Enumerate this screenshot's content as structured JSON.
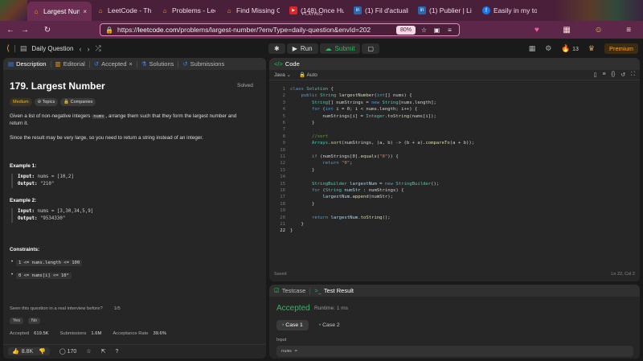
{
  "browser": {
    "tabs": [
      {
        "title": "Largest Numb",
        "icon": "leetcode-icon",
        "active": true
      },
      {
        "title": "LeetCode - The",
        "icon": "leetcode-icon"
      },
      {
        "title": "Problems - Leet",
        "icon": "leetcode-icon"
      },
      {
        "title": "Find Missing Ob",
        "icon": "leetcode-icon"
      },
      {
        "title": "(148) Once Hum",
        "subtitle": "PLAYING",
        "icon": "youtube-icon"
      },
      {
        "title": "(1) Fil d'actualit",
        "icon": "linkedin-icon"
      },
      {
        "title": "(1) Publier | Li",
        "icon": "linkedin-icon"
      },
      {
        "title": "Easily in my to",
        "icon": "facebook-icon"
      }
    ],
    "url_scheme": "https://",
    "url_host": "leetcode.com",
    "url_path": "/problems/largest-number/?envType=daily-question&envId=202",
    "zoom": "80%"
  },
  "header": {
    "daily_label": "Daily Question",
    "run_label": "Run",
    "submit_label": "Submit",
    "streak": "13",
    "premium_label": "Premium"
  },
  "desc_tabs": [
    {
      "label": "Description"
    },
    {
      "label": "Editorial"
    },
    {
      "label": "Accepted"
    },
    {
      "label": "Solutions"
    },
    {
      "label": "Submissions"
    }
  ],
  "problem": {
    "title": "179. Largest Number",
    "solved": "Solved",
    "difficulty": "Medium",
    "topics": "Topics",
    "companies": "Companies",
    "p1_a": "Given a list of non-negative integers ",
    "p1_code": "nums",
    "p1_b": ", arrange them such that they form the largest number and return it.",
    "p2": "Since the result may be very large, so you need to return a string instead of an integer.",
    "ex1_h": "Example 1:",
    "ex1_in_label": "Input:",
    "ex1_in": "nums = [10,2]",
    "ex1_out_label": "Output:",
    "ex1_out": "\"210\"",
    "ex2_h": "Example 2:",
    "ex2_in_label": "Input:",
    "ex2_in": "nums = [3,30,34,5,9]",
    "ex2_out_label": "Output:",
    "ex2_out": "\"9534330\"",
    "cons_h": "Constraints:",
    "c1": "1 <= nums.length <= 100",
    "c2": "0 <= nums[i] <= 10⁹",
    "seen": "Seen this question in a real interview before?",
    "seen_count": "1/5",
    "yes": "Yes",
    "no": "No",
    "accepted_label": "Accepted",
    "accepted_val": "619.5K",
    "subs_label": "Submissions",
    "subs_val": "1.6M",
    "rate_label": "Acceptance Rate",
    "rate_val": "39.6%",
    "likes": "8.8K",
    "comments": "170"
  },
  "code": {
    "tab_label": "Code",
    "language": "Java",
    "auto": "Auto",
    "saved": "Saved",
    "cursor": "Ln 22, Col 2"
  },
  "test": {
    "tab1": "Testcase",
    "tab2": "Test Result",
    "status": "Accepted",
    "runtime": "Runtime: 1 ms",
    "case1": "Case 1",
    "case2": "Case 2",
    "input_label": "Input",
    "input_val": "nums ="
  }
}
